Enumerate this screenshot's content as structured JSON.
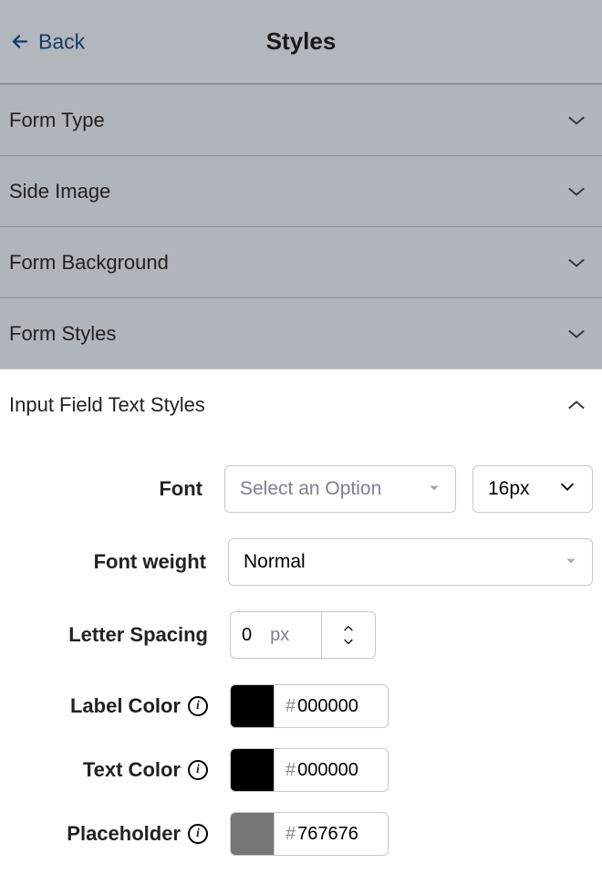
{
  "header": {
    "back_label": "Back",
    "title": "Styles"
  },
  "sections": {
    "form_type": "Form Type",
    "side_image": "Side Image",
    "form_background": "Form Background",
    "form_styles": "Form Styles",
    "input_field_text_styles": "Input Field Text Styles"
  },
  "form": {
    "font_label": "Font",
    "font_placeholder": "Select an Option",
    "font_size_value": "16px",
    "font_weight_label": "Font weight",
    "font_weight_value": "Normal",
    "letter_spacing_label": "Letter Spacing",
    "letter_spacing_value": "0",
    "letter_spacing_unit": "px",
    "label_color_label": "Label Color",
    "label_color_hex": "000000",
    "label_color_swatch": "#000000",
    "text_color_label": "Text Color",
    "text_color_hex": "000000",
    "text_color_swatch": "#000000",
    "placeholder_label": "Placeholder",
    "placeholder_hex": "767676",
    "placeholder_swatch": "#767676",
    "hash": "#"
  }
}
